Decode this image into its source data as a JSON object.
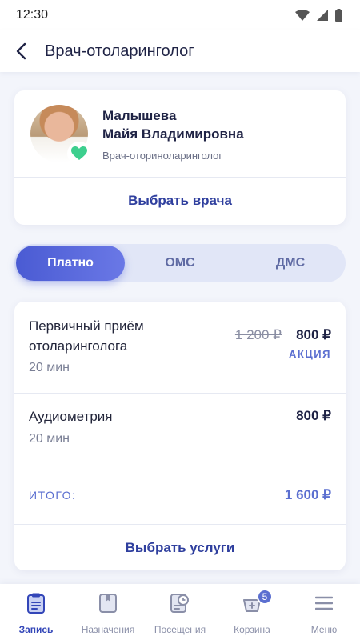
{
  "status_bar": {
    "time": "12:30"
  },
  "app_bar": {
    "title": "Врач-отоларинголог"
  },
  "doctor": {
    "last_name": "Малышева",
    "first_middle_name": "Майя Владимировна",
    "specialty": "Врач-оториноларинголог",
    "action_label": "Выбрать врача"
  },
  "payment_tabs": [
    {
      "label": "Платно",
      "active": true
    },
    {
      "label": "ОМС",
      "active": false
    },
    {
      "label": "ДМС",
      "active": false
    }
  ],
  "services": [
    {
      "name": "Первичный приём отоларинголога",
      "duration": "20 мин",
      "old_price": "1 200 ₽",
      "price": "800 ₽",
      "promo": "АКЦИЯ"
    },
    {
      "name": "Аудиометрия",
      "duration": "20 мин",
      "price": "800 ₽"
    }
  ],
  "total": {
    "label": "ИТОГО:",
    "value": "1 600 ₽"
  },
  "services_action_label": "Выбрать услуги",
  "bottom_nav": [
    {
      "label": "Запись",
      "icon": "clipboard-icon",
      "active": true
    },
    {
      "label": "Назначения",
      "icon": "prescription-icon",
      "active": false
    },
    {
      "label": "Посещения",
      "icon": "visit-history-icon",
      "active": false
    },
    {
      "label": "Корзина",
      "icon": "cart-icon",
      "active": false,
      "badge": "5"
    },
    {
      "label": "Меню",
      "icon": "menu-icon",
      "active": false
    }
  ],
  "colors": {
    "accent": "#4a5bd3",
    "accent_text": "#5b6fd0",
    "heart": "#3dcf8e"
  }
}
